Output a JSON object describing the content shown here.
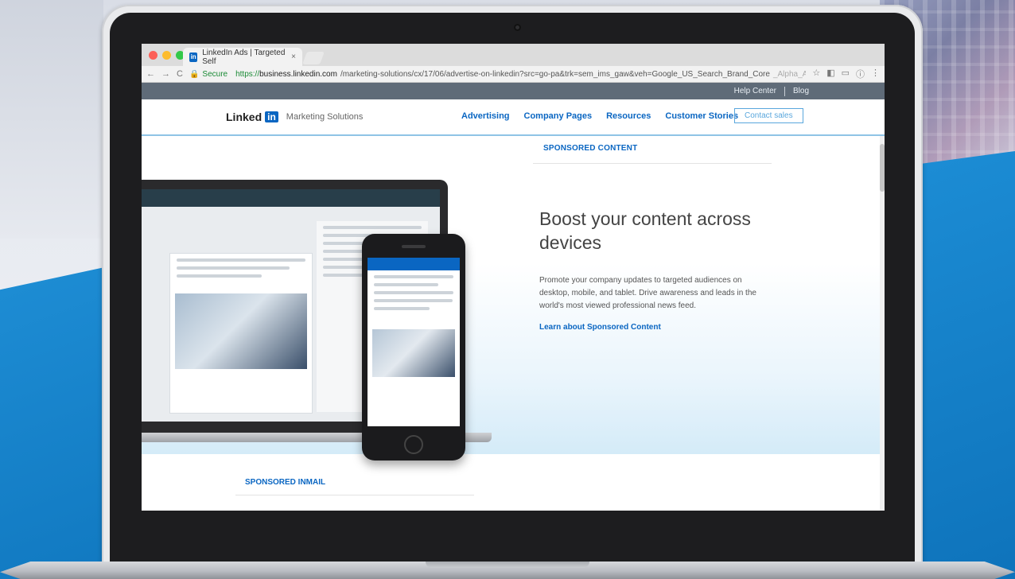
{
  "browser": {
    "tab_title": "LinkedIn Ads | Targeted Self",
    "tab_close": "×",
    "favicon": "in",
    "secure_label": "Secure",
    "url_scheme": "https://",
    "url_host": "business.linkedin.com",
    "url_path": "/marketing-solutions/cx/17/06/advertise-on-linkedin?src=go-pa&trk=sem_ims_gaw&veh=Google_US_Search_Brand_Core",
    "url_tail": "_Alpha_AllDevice_E...",
    "traffic_colors": [
      "#fc5f57",
      "#fdbc2e",
      "#34c84a"
    ]
  },
  "utility": {
    "help_center": "Help Center",
    "blog": "Blog"
  },
  "header": {
    "logo_text": "Linked",
    "logo_in": "in",
    "logo_sub": "Marketing Solutions",
    "nav": [
      "Advertising",
      "Company Pages",
      "Resources",
      "Customer Stories"
    ],
    "contact": "Contact sales"
  },
  "main": {
    "section_label": "SPONSORED CONTENT",
    "headline": "Boost your content across devices",
    "body": "Promote your company updates to targeted audiences on desktop, mobile, and tablet. Drive awareness and leads in the world's most viewed professional news feed.",
    "cta": "Learn about Sponsored Content",
    "next_section": "SPONSORED INMAIL"
  },
  "colors": {
    "brand_blue": "#0a66c2",
    "utility_bar": "#5f6b78"
  }
}
